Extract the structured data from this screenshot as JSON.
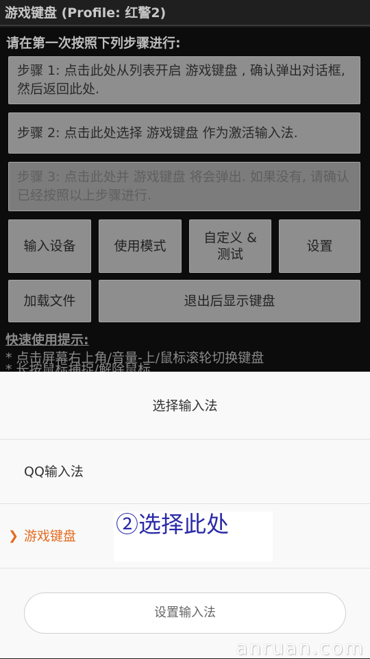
{
  "titlebar": {
    "title": "游戏键盘 (Profile: 红警2)"
  },
  "instructions": "请在第一次按照下列步骤进行:",
  "steps": [
    {
      "label": "步骤 1: 点击此处从列表开启 游戏键盘 , 确认弹出对话框, 然后返回此处."
    },
    {
      "label": "步骤 2: 点击此处选择 游戏键盘 作为激活输入法."
    },
    {
      "label": "步骤 3: 点击此处并 游戏键盘 将会弹出. 如果没有, 请确认已经按照以上步骤进行."
    }
  ],
  "buttons": {
    "input_device": "输入设备",
    "use_mode": "使用模式",
    "custom_test": "自定义 & 测试",
    "settings": "设置",
    "load_file": "加载文件",
    "show_keyboard_on_exit": "退出后显示键盘"
  },
  "tips": {
    "title": "快速使用提示:",
    "lines": [
      "* 点击屏幕右上角/音量-上/鼠标滚轮切换键盘",
      "* 长按鼠标捕捉/解除鼠标"
    ]
  },
  "sheet": {
    "title": "选择输入法",
    "options": [
      {
        "label": "QQ输入法",
        "selected": false
      },
      {
        "label": "游戏键盘",
        "selected": true
      }
    ],
    "annotation": "②选择此处",
    "setup_button": "设置输入法"
  },
  "watermark": "anruan.com",
  "colors": {
    "accent": "#e46a1e",
    "annotation": "#2a2aa8"
  },
  "icons": {
    "selected_marker": "chevron-right-icon"
  }
}
